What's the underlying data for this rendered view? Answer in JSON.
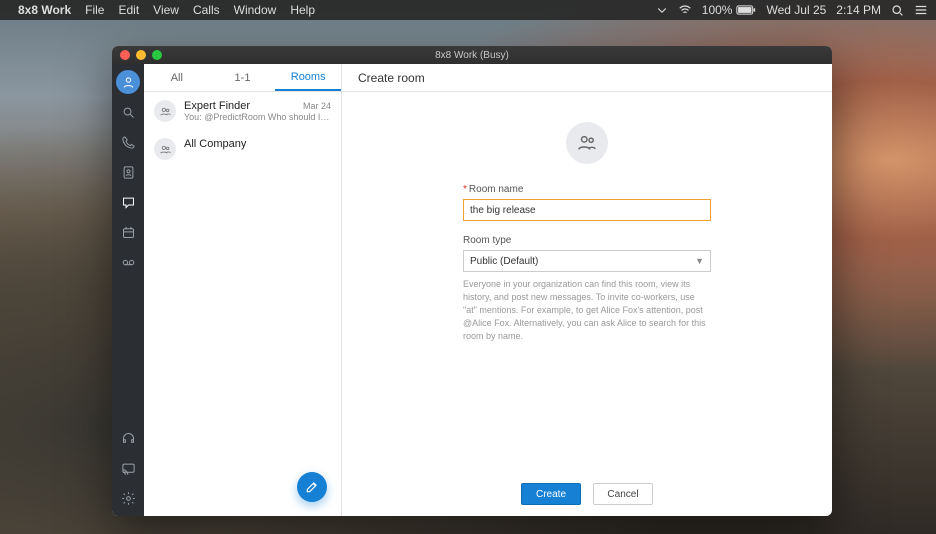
{
  "menubar": {
    "app": "8x8 Work",
    "items": [
      "File",
      "Edit",
      "View",
      "Calls",
      "Window",
      "Help"
    ],
    "battery": "100%",
    "date": "Wed Jul 25",
    "time": "2:14 PM"
  },
  "window": {
    "title": "8x8 Work (Busy)"
  },
  "tabs": {
    "all": "All",
    "oneone": "1-1",
    "rooms": "Rooms"
  },
  "rooms": [
    {
      "name": "Expert Finder",
      "preview": "You: @PredictRoom Who should I ask a...",
      "date": "Mar 24"
    },
    {
      "name": "All Company",
      "preview": "",
      "date": ""
    }
  ],
  "create": {
    "heading": "Create room",
    "name_label": "Room name",
    "name_value": "the big release",
    "type_label": "Room type",
    "type_value": "Public (Default)",
    "help": "Everyone in your organization can find this room, view its history, and post new messages. To invite co-workers, use \"at\" mentions. For example, to get Alice Fox's attention, post @Alice Fox. Alternatively, you can ask Alice to search for this room by name.",
    "create_btn": "Create",
    "cancel_btn": "Cancel"
  }
}
